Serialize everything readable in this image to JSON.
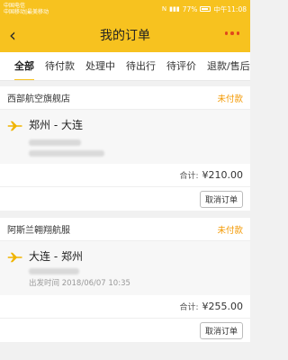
{
  "statusbar": {
    "carrier1": "中国电信",
    "carrier2": "中国移动|最美移动",
    "signal": "N",
    "battery_pct": "77%",
    "time": "中午11:08"
  },
  "header": {
    "title": "我的订单",
    "back_icon": "chevron-left-icon",
    "more_icon": "more-dots-icon"
  },
  "tabs": [
    {
      "label": "全部",
      "active": true
    },
    {
      "label": "待付款"
    },
    {
      "label": "处理中"
    },
    {
      "label": "待出行"
    },
    {
      "label": "待评价"
    },
    {
      "label": "退款/售后"
    }
  ],
  "orders": [
    {
      "shop": "西部航空旗舰店",
      "status": "未付款",
      "route": "郑州 - 大连",
      "depart": "",
      "total_label": "合计:",
      "total": "¥210.00",
      "cancel": "取消订单"
    },
    {
      "shop": "阿斯兰翱翔航服",
      "status": "未付款",
      "route": "大连 - 郑州",
      "depart": "出发时间 2018/06/07 10:35",
      "total_label": "合计:",
      "total": "¥255.00",
      "cancel": "取消订单"
    }
  ],
  "colors": {
    "brand": "#f7c21f",
    "status": "#f39800",
    "plane": "#f0b400"
  }
}
